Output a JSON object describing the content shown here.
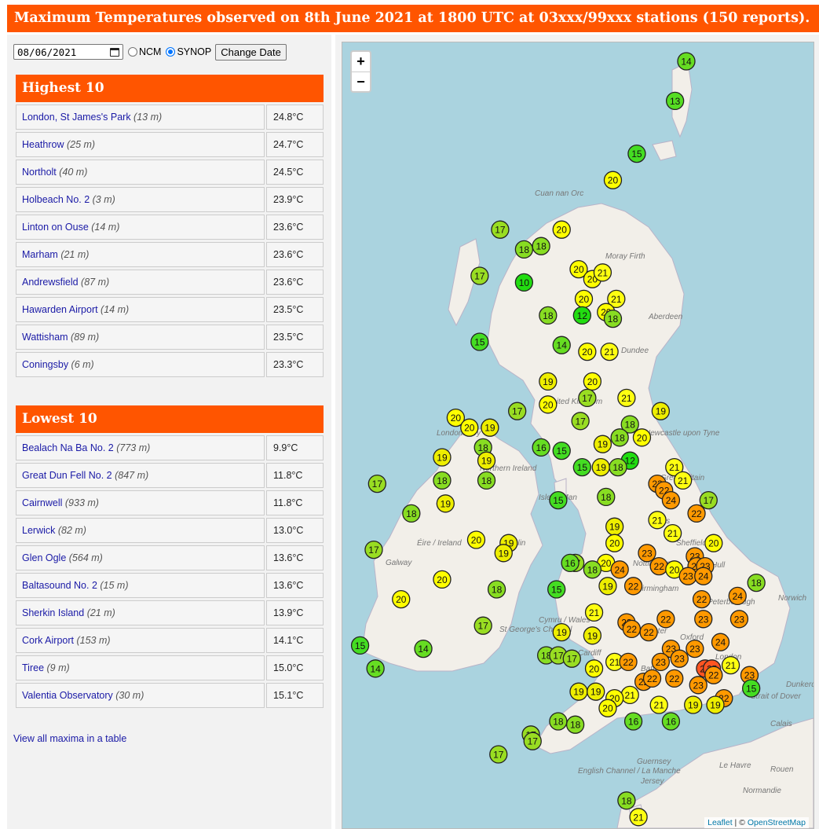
{
  "title": "Maximum Temperatures observed on 8th June 2021 at 1800 UTC at 03xxx/99xxx stations (150 reports).",
  "controls": {
    "date_value": "08/06/2021",
    "radio_ncm": "NCM",
    "radio_synop": "SYNOP",
    "selected": "SYNOP",
    "change_button": "Change Date"
  },
  "highest": {
    "heading": "Highest 10",
    "rows": [
      {
        "name": "London, St James's Park",
        "elev": "(13 m)",
        "value": "24.8°C"
      },
      {
        "name": "Heathrow",
        "elev": "(25 m)",
        "value": "24.7°C"
      },
      {
        "name": "Northolt",
        "elev": "(40 m)",
        "value": "24.5°C"
      },
      {
        "name": "Holbeach No. 2",
        "elev": "(3 m)",
        "value": "23.9°C"
      },
      {
        "name": "Linton on Ouse",
        "elev": "(14 m)",
        "value": "23.6°C"
      },
      {
        "name": "Marham",
        "elev": "(21 m)",
        "value": "23.6°C"
      },
      {
        "name": "Andrewsfield",
        "elev": "(87 m)",
        "value": "23.6°C"
      },
      {
        "name": "Hawarden Airport",
        "elev": "(14 m)",
        "value": "23.5°C"
      },
      {
        "name": "Wattisham",
        "elev": "(89 m)",
        "value": "23.5°C"
      },
      {
        "name": "Coningsby",
        "elev": "(6 m)",
        "value": "23.3°C"
      }
    ]
  },
  "lowest": {
    "heading": "Lowest 10",
    "rows": [
      {
        "name": "Bealach Na Ba No. 2",
        "elev": "(773 m)",
        "value": "9.9°C"
      },
      {
        "name": "Great Dun Fell No. 2",
        "elev": "(847 m)",
        "value": "11.8°C"
      },
      {
        "name": "Cairnwell",
        "elev": "(933 m)",
        "value": "11.8°C"
      },
      {
        "name": "Lerwick",
        "elev": "(82 m)",
        "value": "13.0°C"
      },
      {
        "name": "Glen Ogle",
        "elev": "(564 m)",
        "value": "13.6°C"
      },
      {
        "name": "Baltasound No. 2",
        "elev": "(15 m)",
        "value": "13.6°C"
      },
      {
        "name": "Sherkin Island",
        "elev": "(21 m)",
        "value": "13.9°C"
      },
      {
        "name": "Cork Airport",
        "elev": "(153 m)",
        "value": "14.1°C"
      },
      {
        "name": "Tiree",
        "elev": "(9 m)",
        "value": "15.0°C"
      },
      {
        "name": "Valentia Observatory",
        "elev": "(30 m)",
        "value": "15.1°C"
      }
    ]
  },
  "view_all_link": "View all maxima in a table",
  "map": {
    "zoom_in": "+",
    "zoom_out": "−",
    "attribution_leaflet": "Leaflet",
    "attribution_sep": " | © ",
    "attribution_osm": "OpenStreetMap",
    "place_labels": [
      "Cuan nan Orc",
      "Moray Firth",
      "Aberdeen",
      "Dundee",
      "United Kingdom",
      "Newcastle upon Tyne",
      "Londonderry",
      "Northern Ireland",
      "Great Britain",
      "Isle of Man",
      "Éire / Ireland",
      "Dublin",
      "Galway",
      "Leeds",
      "Sheffield",
      "Nottingham",
      "Birmingham",
      "Hull",
      "Peterborough",
      "Norwich",
      "Cymru / Wales",
      "Gloucester",
      "Cardiff",
      "Oxford",
      "London",
      "Bath",
      "Exeter",
      "St George's Channel",
      "Strait of Dover",
      "Le Havre",
      "Rouen",
      "Guernsey",
      "Jersey",
      "English Channel / La Manche",
      "Normandie",
      "Calais",
      "Dunkerque"
    ],
    "color_scale": {
      "10": "#22dd11",
      "12": "#22dd11",
      "13": "#55dd22",
      "14": "#66dd22",
      "15": "#44dd22",
      "16": "#66dd22",
      "17": "#99dd22",
      "18": "#88dd22",
      "19": "#eeee00",
      "20": "#ffff00",
      "21": "#ffff11",
      "22": "#ff9900",
      "23": "#ff9900",
      "24": "#ff9900",
      "25": "#ff5522"
    }
  },
  "stations": [
    {
      "t": "14",
      "lat": 60.75,
      "lon": -0.85
    },
    {
      "t": "13",
      "lat": 60.15,
      "lon": -1.18
    },
    {
      "t": "15",
      "lat": 59.35,
      "lon": -2.3
    },
    {
      "t": "20",
      "lat": 58.95,
      "lon": -3.0
    },
    {
      "t": "17",
      "lat": 58.2,
      "lon": -6.3
    },
    {
      "t": "20",
      "lat": 58.2,
      "lon": -4.5
    },
    {
      "t": "18",
      "lat": 57.9,
      "lon": -5.6
    },
    {
      "t": "18",
      "lat": 57.95,
      "lon": -5.1
    },
    {
      "t": "20",
      "lat": 57.6,
      "lon": -4.0
    },
    {
      "t": "20",
      "lat": 57.45,
      "lon": -3.6
    },
    {
      "t": "21",
      "lat": 57.55,
      "lon": -3.3
    },
    {
      "t": "17",
      "lat": 57.5,
      "lon": -6.9
    },
    {
      "t": "10",
      "lat": 57.4,
      "lon": -5.6
    },
    {
      "t": "20",
      "lat": 57.15,
      "lon": -3.85
    },
    {
      "t": "21",
      "lat": 57.15,
      "lon": -2.9
    },
    {
      "t": "20",
      "lat": 56.95,
      "lon": -3.2
    },
    {
      "t": "18",
      "lat": 56.9,
      "lon": -4.9
    },
    {
      "t": "12",
      "lat": 56.9,
      "lon": -3.9
    },
    {
      "t": "18",
      "lat": 56.85,
      "lon": -3.0
    },
    {
      "t": "15",
      "lat": 56.5,
      "lon": -6.9
    },
    {
      "t": "14",
      "lat": 56.45,
      "lon": -4.5
    },
    {
      "t": "20",
      "lat": 56.35,
      "lon": -3.75
    },
    {
      "t": "21",
      "lat": 56.35,
      "lon": -3.1
    },
    {
      "t": "19",
      "lat": 55.9,
      "lon": -4.9
    },
    {
      "t": "20",
      "lat": 55.9,
      "lon": -3.6
    },
    {
      "t": "21",
      "lat": 55.65,
      "lon": -2.6
    },
    {
      "t": "20",
      "lat": 55.55,
      "lon": -4.9
    },
    {
      "t": "17",
      "lat": 55.65,
      "lon": -3.75
    },
    {
      "t": "19",
      "lat": 55.45,
      "lon": -1.6
    },
    {
      "t": "17",
      "lat": 55.45,
      "lon": -5.8
    },
    {
      "t": "20",
      "lat": 55.35,
      "lon": -7.6
    },
    {
      "t": "17",
      "lat": 55.3,
      "lon": -3.95
    },
    {
      "t": "18",
      "lat": 55.25,
      "lon": -2.5
    },
    {
      "t": "20",
      "lat": 55.2,
      "lon": -7.2
    },
    {
      "t": "19",
      "lat": 55.2,
      "lon": -6.6
    },
    {
      "t": "18",
      "lat": 55.05,
      "lon": -2.8
    },
    {
      "t": "20",
      "lat": 55.05,
      "lon": -2.15
    },
    {
      "t": "19",
      "lat": 54.95,
      "lon": -3.3
    },
    {
      "t": "16",
      "lat": 54.9,
      "lon": -5.1
    },
    {
      "t": "18",
      "lat": 54.9,
      "lon": -6.8
    },
    {
      "t": "15",
      "lat": 54.85,
      "lon": -4.5
    },
    {
      "t": "19",
      "lat": 54.75,
      "lon": -8.0
    },
    {
      "t": "19",
      "lat": 54.7,
      "lon": -6.7
    },
    {
      "t": "12",
      "lat": 54.7,
      "lon": -2.5
    },
    {
      "t": "15",
      "lat": 54.6,
      "lon": -3.9
    },
    {
      "t": "19",
      "lat": 54.6,
      "lon": -3.35
    },
    {
      "t": "18",
      "lat": 54.6,
      "lon": -2.85
    },
    {
      "t": "21",
      "lat": 54.6,
      "lon": -1.2
    },
    {
      "t": "18",
      "lat": 54.4,
      "lon": -8.0
    },
    {
      "t": "18",
      "lat": 54.4,
      "lon": -6.7
    },
    {
      "t": "22",
      "lat": 54.35,
      "lon": -1.7
    },
    {
      "t": "21",
      "lat": 54.4,
      "lon": -0.95
    },
    {
      "t": "17",
      "lat": 54.35,
      "lon": -9.9
    },
    {
      "t": "22",
      "lat": 54.25,
      "lon": -1.5
    },
    {
      "t": "24",
      "lat": 54.1,
      "lon": -1.3
    },
    {
      "t": "15",
      "lat": 54.1,
      "lon": -4.6
    },
    {
      "t": "18",
      "lat": 54.15,
      "lon": -3.2
    },
    {
      "t": "19",
      "lat": 54.05,
      "lon": -7.9
    },
    {
      "t": "17",
      "lat": 54.1,
      "lon": -0.2
    },
    {
      "t": "18",
      "lat": 53.9,
      "lon": -8.9
    },
    {
      "t": "22",
      "lat": 53.9,
      "lon": -0.55
    },
    {
      "t": "21",
      "lat": 53.8,
      "lon": -1.7
    },
    {
      "t": "19",
      "lat": 53.7,
      "lon": -2.95
    },
    {
      "t": "21",
      "lat": 53.6,
      "lon": -1.25
    },
    {
      "t": "20",
      "lat": 53.5,
      "lon": -7.0
    },
    {
      "t": "20",
      "lat": 53.45,
      "lon": -2.95
    },
    {
      "t": "19",
      "lat": 53.45,
      "lon": -6.05
    },
    {
      "t": "20",
      "lat": 53.45,
      "lon": -0.05
    },
    {
      "t": "17",
      "lat": 53.35,
      "lon": -10.0
    },
    {
      "t": "19",
      "lat": 53.3,
      "lon": -6.2
    },
    {
      "t": "23",
      "lat": 53.3,
      "lon": -2.0
    },
    {
      "t": "23",
      "lat": 53.25,
      "lon": -0.6
    },
    {
      "t": "23",
      "lat": 53.1,
      "lon": -0.55
    },
    {
      "t": "23",
      "lat": 53.1,
      "lon": -0.3
    },
    {
      "t": "17",
      "lat": 53.15,
      "lon": -4.1
    },
    {
      "t": "16",
      "lat": 53.15,
      "lon": -4.25
    },
    {
      "t": "20",
      "lat": 53.15,
      "lon": -3.2
    },
    {
      "t": "18",
      "lat": 53.05,
      "lon": -3.6
    },
    {
      "t": "24",
      "lat": 53.05,
      "lon": -2.8
    },
    {
      "t": "22",
      "lat": 53.1,
      "lon": -1.65
    },
    {
      "t": "20",
      "lat": 53.05,
      "lon": -1.2
    },
    {
      "t": "23",
      "lat": 52.95,
      "lon": -0.8
    },
    {
      "t": "24",
      "lat": 52.95,
      "lon": -0.35
    },
    {
      "t": "18",
      "lat": 52.85,
      "lon": 1.2
    },
    {
      "t": "20",
      "lat": 52.9,
      "lon": -8.0
    },
    {
      "t": "18",
      "lat": 52.75,
      "lon": -6.4
    },
    {
      "t": "19",
      "lat": 52.8,
      "lon": -3.15
    },
    {
      "t": "22",
      "lat": 52.8,
      "lon": -2.4
    },
    {
      "t": "15",
      "lat": 52.75,
      "lon": -4.65
    },
    {
      "t": "24",
      "lat": 52.65,
      "lon": 0.65
    },
    {
      "t": "22",
      "lat": 52.6,
      "lon": -0.4
    },
    {
      "t": "20",
      "lat": 52.6,
      "lon": -9.2
    },
    {
      "t": "21",
      "lat": 52.4,
      "lon": -3.55
    },
    {
      "t": "23",
      "lat": 52.25,
      "lon": -2.6
    },
    {
      "t": "22",
      "lat": 52.3,
      "lon": -1.45
    },
    {
      "t": "23",
      "lat": 52.3,
      "lon": -0.35
    },
    {
      "t": "23",
      "lat": 52.3,
      "lon": 0.7
    },
    {
      "t": "22",
      "lat": 52.15,
      "lon": -2.45
    },
    {
      "t": "22",
      "lat": 52.1,
      "lon": -1.95
    },
    {
      "t": "17",
      "lat": 52.2,
      "lon": -6.8
    },
    {
      "t": "19",
      "lat": 52.1,
      "lon": -4.5
    },
    {
      "t": "19",
      "lat": 52.05,
      "lon": -3.6
    },
    {
      "t": "15",
      "lat": 51.9,
      "lon": -10.4
    },
    {
      "t": "14",
      "lat": 51.85,
      "lon": -8.55
    },
    {
      "t": "24",
      "lat": 51.95,
      "lon": 0.15
    },
    {
      "t": "23",
      "lat": 51.85,
      "lon": -0.6
    },
    {
      "t": "23",
      "lat": 51.85,
      "lon": -1.3
    },
    {
      "t": "18",
      "lat": 51.75,
      "lon": -4.95
    },
    {
      "t": "17",
      "lat": 51.75,
      "lon": -4.6
    },
    {
      "t": "17",
      "lat": 51.7,
      "lon": -4.2
    },
    {
      "t": "23",
      "lat": 51.7,
      "lon": -1.05
    },
    {
      "t": "21",
      "lat": 51.65,
      "lon": -2.95
    },
    {
      "t": "22",
      "lat": 51.65,
      "lon": -2.55
    },
    {
      "t": "23",
      "lat": 51.65,
      "lon": -1.6
    },
    {
      "t": "25",
      "lat": 51.55,
      "lon": -0.3
    },
    {
      "t": "25",
      "lat": 51.55,
      "lon": -0.1
    },
    {
      "t": "21",
      "lat": 51.6,
      "lon": 0.45
    },
    {
      "t": "14",
      "lat": 51.55,
      "lon": -9.95
    },
    {
      "t": "20",
      "lat": 51.55,
      "lon": -3.55
    },
    {
      "t": "22",
      "lat": 51.45,
      "lon": -0.05
    },
    {
      "t": "23",
      "lat": 51.45,
      "lon": 1.0
    },
    {
      "t": "22",
      "lat": 51.35,
      "lon": -2.1
    },
    {
      "t": "22",
      "lat": 51.4,
      "lon": -1.85
    },
    {
      "t": "22",
      "lat": 51.4,
      "lon": -1.2
    },
    {
      "t": "23",
      "lat": 51.3,
      "lon": -0.5
    },
    {
      "t": "15",
      "lat": 51.25,
      "lon": 1.05
    },
    {
      "t": "19",
      "lat": 51.2,
      "lon": -4.0
    },
    {
      "t": "19",
      "lat": 51.2,
      "lon": -3.5
    },
    {
      "t": "21",
      "lat": 51.15,
      "lon": -2.5
    },
    {
      "t": "20",
      "lat": 51.1,
      "lon": -2.95
    },
    {
      "t": "22",
      "lat": 51.1,
      "lon": 0.25
    },
    {
      "t": "21",
      "lat": 51.0,
      "lon": -1.65
    },
    {
      "t": "19",
      "lat": 51.0,
      "lon": -0.65
    },
    {
      "t": "19",
      "lat": 51.0,
      "lon": -0.0
    },
    {
      "t": "20",
      "lat": 50.95,
      "lon": -3.15
    },
    {
      "t": "16",
      "lat": 50.75,
      "lon": -2.4
    },
    {
      "t": "16",
      "lat": 50.75,
      "lon": -1.3
    },
    {
      "t": "18",
      "lat": 50.75,
      "lon": -4.6
    },
    {
      "t": "18",
      "lat": 50.7,
      "lon": -4.1
    },
    {
      "t": "17",
      "lat": 50.55,
      "lon": -5.4
    },
    {
      "t": "17",
      "lat": 50.45,
      "lon": -5.35
    },
    {
      "t": "17",
      "lat": 50.25,
      "lon": -6.35
    },
    {
      "t": "18",
      "lat": 49.55,
      "lon": -2.6
    },
    {
      "t": "21",
      "lat": 49.3,
      "lon": -2.25
    }
  ]
}
